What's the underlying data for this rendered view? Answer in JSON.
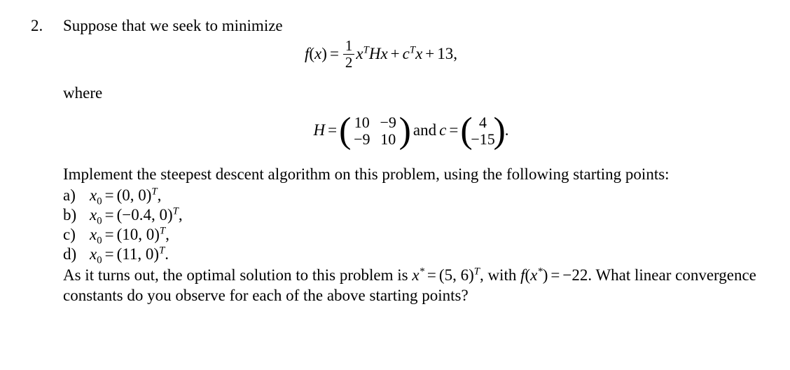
{
  "problem": {
    "number": "2.",
    "prompt": "Suppose that we seek to minimize",
    "where_label": "where",
    "equation_f": {
      "lhs_f": "f",
      "lhs_open": "(",
      "lhs_var": "x",
      "lhs_close": ")",
      "equals": "=",
      "frac_num": "1",
      "frac_den": "2",
      "term1_var": "x",
      "term1_sup": "T",
      "term1_matrix": "H",
      "term1_var2": "x",
      "plus": "+",
      "term2_var": "c",
      "term2_sup": "T",
      "term2_var2": "x",
      "plus2": "+",
      "constant": "13",
      "comma": ","
    },
    "definitions": {
      "H_symbol": "H",
      "equals": "=",
      "H_rows": [
        [
          "10",
          "−9"
        ],
        [
          "−9",
          "10"
        ]
      ],
      "conjunction": "and",
      "c_symbol": "c",
      "equals2": "=",
      "c_rows": [
        [
          "4"
        ],
        [
          "−15"
        ]
      ],
      "period": "."
    },
    "instruction": "Implement the steepest descent algorithm on this problem, using the following starting points:",
    "starting_points": [
      {
        "label": "a)",
        "var": "x",
        "sub": "0",
        "equals": "=",
        "open": "(",
        "values": "0, 0",
        "close": ")",
        "sup": "T",
        "punct": ","
      },
      {
        "label": "b)",
        "var": "x",
        "sub": "0",
        "equals": "=",
        "open": "(",
        "values": "−0.4, 0",
        "close": ")",
        "sup": "T",
        "punct": ","
      },
      {
        "label": "c)",
        "var": "x",
        "sub": "0",
        "equals": "=",
        "open": "(",
        "values": "10, 0",
        "close": ")",
        "sup": "T",
        "punct": ","
      },
      {
        "label": "d)",
        "var": "x",
        "sub": "0",
        "equals": "=",
        "open": "(",
        "values": "11, 0",
        "close": ")",
        "sup": "T",
        "punct": "."
      }
    ],
    "conclusion": {
      "text_a": "As it turns out, the optimal solution to this problem is ",
      "x_star_var": "x",
      "x_star_sup": "*",
      "equals": "=",
      "open": "(",
      "x_star_values": "5, 6",
      "close": ")",
      "sup_T": "T",
      "text_b": ", with ",
      "f_sym": "f",
      "f_open": "(",
      "f_var": "x",
      "f_sup": "*",
      "f_close": ")",
      "equals2": "=",
      "value": "−22.",
      "text_c": " What linear convergence constants do you observe for each of the above starting points?"
    }
  }
}
